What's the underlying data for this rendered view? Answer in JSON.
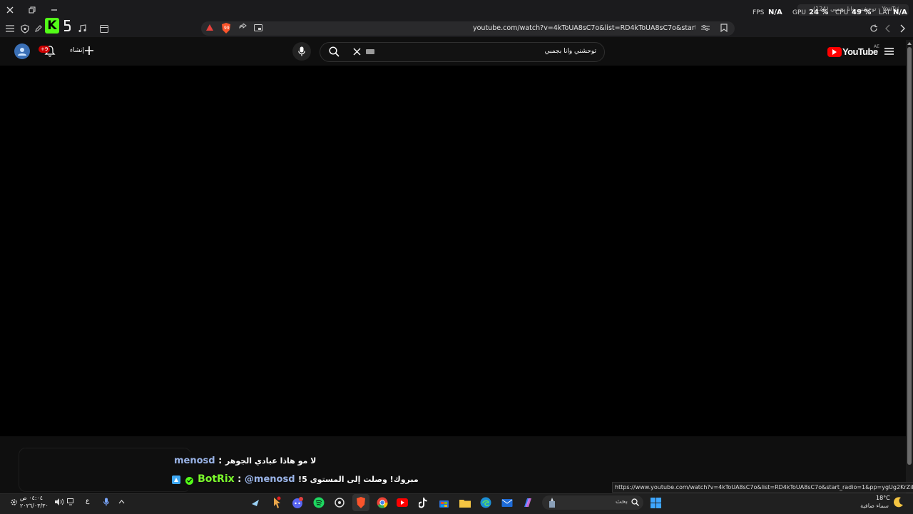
{
  "overlay": {
    "fps_label": "FPS",
    "fps_value": "N/A",
    "gpu_label": "GPU",
    "gpu_value": "24 %",
    "cpu_label": "CPU",
    "cpu_value": "49 %",
    "lat_label": "LAT",
    "lat_value": "N/A",
    "tab_title": "(124) توحشني وانا بجمبي - YouTube"
  },
  "browser": {
    "url": "youtube.com/watch?v=4kToUA8sC7o&list=RD4kToUA8sC7o&start_radio=1",
    "status_url": "https://www.youtube.com/watch?v=4kToUA8sC7o&list=RD4kToUA8sC7o&start_radio=1&pp=ygUg2KrZiNit2LTZhtm..."
  },
  "youtube": {
    "logo_text": "YouTube",
    "region": "AE",
    "search_value": "توحشني وانا بجمبي",
    "create_label": "إنشاء",
    "notif_count": "+9"
  },
  "chat": {
    "line1_user": "menosd",
    "line1_sep": " : ",
    "line1_text": "لا مو هاذا عبادي الجوهر",
    "line2_user": "BotRix",
    "line2_sep": " : ",
    "line2_mention": "@menosd",
    "line2_text": "مبروك! وصلت إلى المستوى 5!"
  },
  "taskbar": {
    "search_placeholder": "بحث",
    "time": "٠٤:٠٤ ص",
    "date": "٢٠٢٦/٠٣/٣٠",
    "lang": "ع",
    "weather_temp": "18°C",
    "weather_text": "سماء صافية"
  },
  "colors": {
    "accent_green": "#53fc18",
    "youtube_red": "#ff0000",
    "botrix_green": "#7cfc2c",
    "chat_user_blue": "#9ab4e8"
  }
}
